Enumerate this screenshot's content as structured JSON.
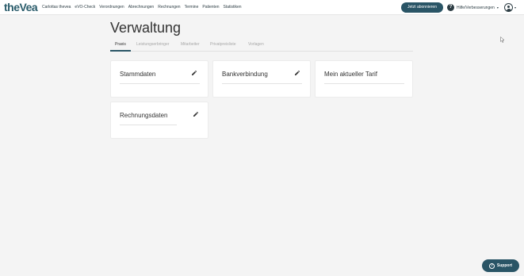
{
  "header": {
    "logo": "theVea",
    "nav": [
      "Carlottas thevea",
      "eVO-Check",
      "Verordnungen",
      "Abrechnungen",
      "Rechnungen",
      "Termine",
      "Patienten",
      "Statistiken"
    ],
    "subscribe_label": "Jetzt abonnieren",
    "help_icon": "?",
    "help_label": "Hilfe/Verbesserungen",
    "caret": "▾",
    "avatar_icon": "user-avatar-icon"
  },
  "page": {
    "title": "Verwaltung",
    "tabs": [
      "Praxis",
      "Leistungserbringer",
      "Mitarbeiter",
      "Privatpreisliste",
      "Vorlagen"
    ],
    "active_tab": "Praxis"
  },
  "cards": {
    "stammdaten": "Stammdaten",
    "bankverbindung": "Bankverbindung",
    "tarif": "Mein aktueller Tarif",
    "rechnungsdaten": "Rechnungsdaten"
  },
  "support": {
    "icon": "?",
    "label": "Support"
  },
  "colors": {
    "brand": "#2a5566",
    "background": "#f4f4f4"
  }
}
